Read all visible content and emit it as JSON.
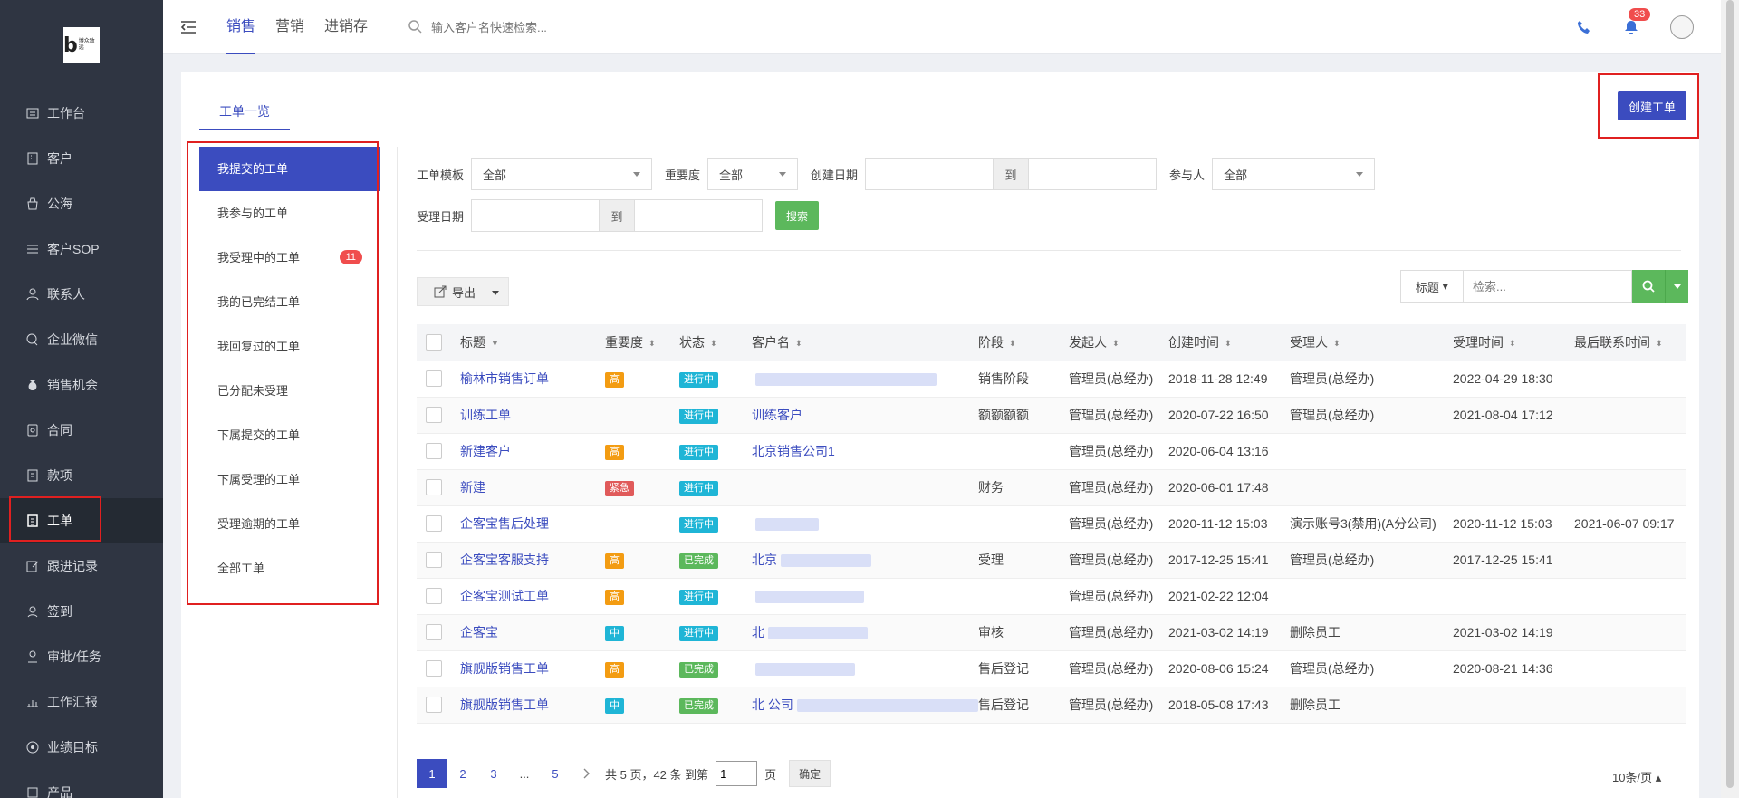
{
  "logo": {
    "text": "博众致远"
  },
  "sidebar": {
    "items": [
      {
        "label": "工作台",
        "icon": "desk-icon"
      },
      {
        "label": "客户",
        "icon": "building-icon"
      },
      {
        "label": "公海",
        "icon": "pool-icon"
      },
      {
        "label": "客户SOP",
        "icon": "sop-icon"
      },
      {
        "label": "联系人",
        "icon": "person-icon"
      },
      {
        "label": "企业微信",
        "icon": "wechat-icon"
      },
      {
        "label": "销售机会",
        "icon": "moneybag-icon"
      },
      {
        "label": "合同",
        "icon": "contract-icon"
      },
      {
        "label": "款项",
        "icon": "payment-icon"
      },
      {
        "label": "工单",
        "icon": "ticket-icon"
      },
      {
        "label": "跟进记录",
        "icon": "edit-icon"
      },
      {
        "label": "签到",
        "icon": "location-icon"
      },
      {
        "label": "审批/任务",
        "icon": "approval-icon"
      },
      {
        "label": "工作汇报",
        "icon": "report-icon"
      },
      {
        "label": "业绩目标",
        "icon": "target-icon"
      },
      {
        "label": "产品",
        "icon": "product-icon"
      }
    ]
  },
  "header": {
    "tabs": [
      "销售",
      "营销",
      "进销存"
    ],
    "search_placeholder": "输入客户名快速检索...",
    "notifications": "33"
  },
  "page": {
    "tab": "工单一览",
    "create_button": "创建工单"
  },
  "left_list": {
    "items": [
      "我提交的工单",
      "我参与的工单",
      "我受理中的工单",
      "我的已完结工单",
      "我回复过的工单",
      "已分配未受理",
      "下属提交的工单",
      "下属受理的工单",
      "受理逾期的工单",
      "全部工单"
    ],
    "count_badge": "11"
  },
  "filters": {
    "template_label": "工单模板",
    "template_value": "全部",
    "priority_label": "重要度",
    "priority_value": "全部",
    "created_label": "创建日期",
    "to": "到",
    "participant_label": "参与人",
    "participant_value": "全部",
    "accept_label": "受理日期",
    "search_button": "搜索"
  },
  "toolbar": {
    "export_label": "导出",
    "field_select": "标题",
    "search_placeholder": "检索..."
  },
  "table": {
    "headers": [
      "标题",
      "重要度",
      "状态",
      "客户名",
      "阶段",
      "发起人",
      "创建时间",
      "受理人",
      "受理时间",
      "最后联系时间"
    ],
    "rows": [
      {
        "title": "榆林市销售订单",
        "priority": "高",
        "status": "进行中",
        "customer": "",
        "stage": "销售阶段",
        "creator": "管理员(总经办)",
        "created": "2018-11-28 12:49",
        "assignee": "管理员(总经办)",
        "accepted": "2022-04-29 18:30",
        "last": ""
      },
      {
        "title": "训练工单",
        "priority": "",
        "status": "进行中",
        "customer": "训练客户",
        "stage": "额额额额",
        "creator": "管理员(总经办)",
        "created": "2020-07-22 16:50",
        "assignee": "管理员(总经办)",
        "accepted": "2021-08-04 17:12",
        "last": ""
      },
      {
        "title": "新建客户",
        "priority": "高",
        "status": "进行中",
        "customer": "北京销售公司1",
        "stage": "",
        "creator": "管理员(总经办)",
        "created": "2020-06-04 13:16",
        "assignee": "",
        "accepted": "",
        "last": ""
      },
      {
        "title": "新建",
        "priority": "紧急",
        "status": "进行中",
        "customer": "",
        "stage": "财务",
        "creator": "管理员(总经办)",
        "created": "2020-06-01 17:48",
        "assignee": "",
        "accepted": "",
        "last": ""
      },
      {
        "title": "企客宝售后处理",
        "priority": "",
        "status": "进行中",
        "customer": "",
        "stage": "",
        "creator": "管理员(总经办)",
        "created": "2020-11-12 15:03",
        "assignee": "演示账号3(禁用)(A分公司)",
        "accepted": "2020-11-12 15:03",
        "last": "2021-06-07 09:17"
      },
      {
        "title": "企客宝客服支持",
        "priority": "高",
        "status": "已完成",
        "customer": "北京",
        "stage": "受理",
        "creator": "管理员(总经办)",
        "created": "2017-12-25 15:41",
        "assignee": "管理员(总经办)",
        "accepted": "2017-12-25 15:41",
        "last": ""
      },
      {
        "title": "企客宝测试工单",
        "priority": "高",
        "status": "进行中",
        "customer": "",
        "stage": "",
        "creator": "管理员(总经办)",
        "created": "2021-02-22 12:04",
        "assignee": "",
        "accepted": "",
        "last": ""
      },
      {
        "title": "企客宝",
        "priority": "中",
        "status": "进行中",
        "customer": "北",
        "stage": "审核",
        "creator": "管理员(总经办)",
        "created": "2021-03-02 14:19",
        "assignee": "删除员工",
        "accepted": "2021-03-02 14:19",
        "last": ""
      },
      {
        "title": "旗舰版销售工单",
        "priority": "高",
        "status": "已完成",
        "customer": "",
        "stage": "售后登记",
        "creator": "管理员(总经办)",
        "created": "2020-08-06 15:24",
        "assignee": "管理员(总经办)",
        "accepted": "2020-08-21 14:36",
        "last": ""
      },
      {
        "title": "旗舰版销售工单",
        "priority": "中",
        "status": "已完成",
        "customer": "北 公司",
        "stage": "售后登记",
        "creator": "管理员(总经办)",
        "created": "2018-05-08 17:43",
        "assignee": "删除员工",
        "accepted": "",
        "last": ""
      }
    ]
  },
  "pager": {
    "pages": [
      "1",
      "2",
      "3",
      "...",
      "5"
    ],
    "summary": "共 5 页，42 条 到第",
    "current_input": "1",
    "page_unit": "页",
    "confirm": "确定",
    "per_page": "10条/页"
  },
  "colors": {
    "primary": "#3b4cbf",
    "green": "#5cb85c",
    "high": "#f39c12",
    "urgent": "#e05a5a",
    "medium": "#1fb5d6",
    "in_progress": "#1fb5d6",
    "done": "#5cb85c",
    "annotation": "#e02020"
  }
}
